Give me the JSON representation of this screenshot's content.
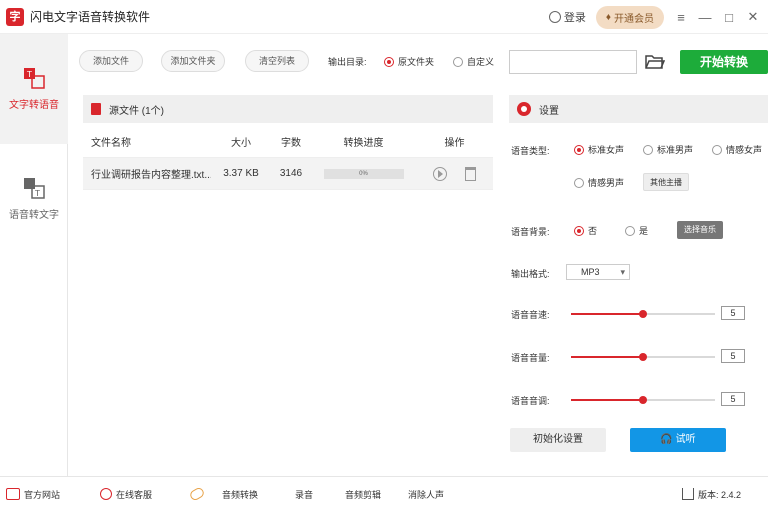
{
  "app": {
    "title": "闪电文字语音转换软件",
    "logo_char": "字"
  },
  "titlebar": {
    "login_label": "登录",
    "vip_label": "开通会员",
    "menu_icon": "≡",
    "min_icon": "—",
    "max_icon": "□",
    "close_icon": "✕"
  },
  "sidebar": {
    "items": [
      {
        "label": "文字转语音",
        "active": true
      },
      {
        "label": "语音转文字",
        "active": false
      }
    ]
  },
  "toolbar": {
    "add_file": "添加文件",
    "add_folder": "添加文件夹",
    "clear_list": "清空列表",
    "output_label": "输出目录:",
    "output_options": [
      "原文件夹",
      "自定义"
    ],
    "output_selected": "原文件夹",
    "path_value": "",
    "start_button": "开始转换"
  },
  "file_panel": {
    "header": "源文件 (1个)",
    "columns": [
      "文件名称",
      "大小",
      "字数",
      "转换进度",
      "操作"
    ],
    "rows": [
      {
        "name": "行业调研报告内容整理.txt...",
        "size": "3.37 KB",
        "chars": "3146",
        "progress": 0,
        "progress_text": "0%"
      }
    ]
  },
  "settings": {
    "header": "设置",
    "voice_type_label": "语音类型:",
    "voice_options": [
      "标准女声",
      "标准男声",
      "情感女声",
      "情感男声"
    ],
    "voice_selected": "标准女声",
    "other_voices_btn": "其他主播",
    "bg_label": "语音背景:",
    "bg_options": [
      "否",
      "是"
    ],
    "bg_selected": "否",
    "choose_music_btn": "选择音乐",
    "format_label": "输出格式:",
    "format_value": "MP3",
    "speed_label": "语音音速:",
    "speed_value": "5",
    "volume_label": "语音音量:",
    "volume_value": "5",
    "pitch_label": "语音音调:",
    "pitch_value": "5",
    "slider_fraction": 0.5,
    "reset_btn": "初始化设置",
    "listen_btn": "试听"
  },
  "footer": {
    "website": "官方网站",
    "support": "在线客服",
    "links": [
      "音频转换",
      "录音",
      "音频剪辑",
      "消除人声"
    ],
    "version_label": "版本: 2.4.2"
  },
  "colors": {
    "accent": "#d9262c",
    "start": "#1dac3a",
    "listen": "#1296e6"
  }
}
